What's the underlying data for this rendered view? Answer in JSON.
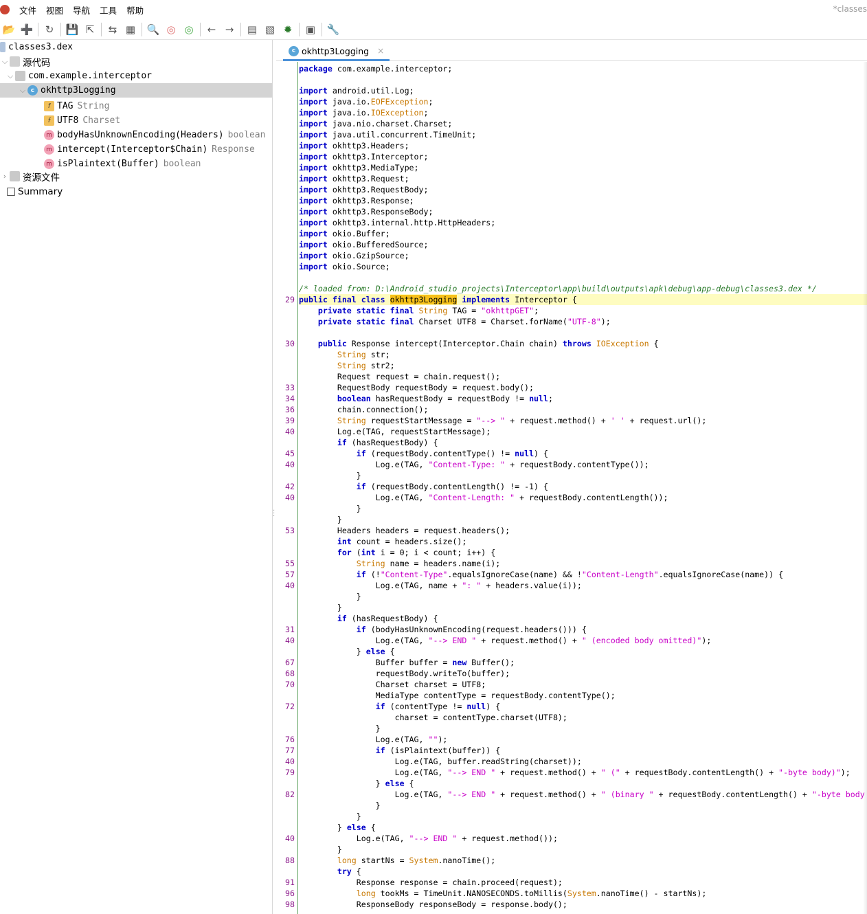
{
  "menu": {
    "items": [
      "文件",
      "视图",
      "导航",
      "工具",
      "帮助"
    ],
    "window_title": "*classes"
  },
  "toolbar": {
    "icons": [
      "open-icon",
      "add-files-icon",
      "reload-icon",
      "save-icon",
      "export-icon",
      "sync-icon",
      "tree-icon",
      "search-icon",
      "search-class-icon",
      "search-usage-icon",
      "back-icon",
      "forward-icon",
      "log-icon",
      "quark-icon",
      "debug-icon",
      "logs-icon",
      "prefs-icon"
    ]
  },
  "tree": {
    "root": "classes3.dex",
    "source_node": "源代码",
    "package": "com.example.interceptor",
    "class": "okhttp3Logging",
    "members": [
      {
        "icon": "f",
        "name": "TAG",
        "type": "String"
      },
      {
        "icon": "f",
        "name": "UTF8",
        "type": "Charset"
      },
      {
        "icon": "m",
        "name": "bodyHasUnknownEncoding(Headers)",
        "type": "boolean"
      },
      {
        "icon": "m",
        "name": "intercept(Interceptor$Chain)",
        "type": "Response"
      },
      {
        "icon": "m",
        "name": "isPlaintext(Buffer)",
        "type": "boolean"
      }
    ],
    "resources": "资源文件",
    "summary": "Summary"
  },
  "editor": {
    "tab_title": "okhttp3Logging",
    "tab_close": "×",
    "lines": [
      {
        "n": "",
        "html": "<span class=\"kw\">package</span> com.example.interceptor;"
      },
      {
        "n": "",
        "html": ""
      },
      {
        "n": "",
        "html": "<span class=\"kw\">import</span> android.util.Log;"
      },
      {
        "n": "",
        "html": "<span class=\"kw\">import</span> java.io.<span class=\"ty\">EOFException</span>;"
      },
      {
        "n": "",
        "html": "<span class=\"kw\">import</span> java.io.<span class=\"ty\">IOException</span>;"
      },
      {
        "n": "",
        "html": "<span class=\"kw\">import</span> java.nio.charset.Charset;"
      },
      {
        "n": "",
        "html": "<span class=\"kw\">import</span> java.util.concurrent.TimeUnit;"
      },
      {
        "n": "",
        "html": "<span class=\"kw\">import</span> okhttp3.Headers;"
      },
      {
        "n": "",
        "html": "<span class=\"kw\">import</span> okhttp3.Interceptor;"
      },
      {
        "n": "",
        "html": "<span class=\"kw\">import</span> okhttp3.MediaType;"
      },
      {
        "n": "",
        "html": "<span class=\"kw\">import</span> okhttp3.Request;"
      },
      {
        "n": "",
        "html": "<span class=\"kw\">import</span> okhttp3.RequestBody;"
      },
      {
        "n": "",
        "html": "<span class=\"kw\">import</span> okhttp3.Response;"
      },
      {
        "n": "",
        "html": "<span class=\"kw\">import</span> okhttp3.ResponseBody;"
      },
      {
        "n": "",
        "html": "<span class=\"kw\">import</span> okhttp3.internal.http.HttpHeaders;"
      },
      {
        "n": "",
        "html": "<span class=\"kw\">import</span> okio.Buffer;"
      },
      {
        "n": "",
        "html": "<span class=\"kw\">import</span> okio.BufferedSource;"
      },
      {
        "n": "",
        "html": "<span class=\"kw\">import</span> okio.GzipSource;"
      },
      {
        "n": "",
        "html": "<span class=\"kw\">import</span> okio.Source;"
      },
      {
        "n": "",
        "html": ""
      },
      {
        "n": "",
        "html": "<span class=\"cm\">/* loaded from: D:\\Android_studio_projects\\Interceptor\\app\\build\\outputs\\apk\\debug\\app-debug\\classes3.dex */</span>"
      },
      {
        "n": "29",
        "hl": true,
        "html": "<span class=\"kw\">public final class</span> <span class=\"hlname\">okhttp3Logging</span> <span class=\"kw\">implements</span> Interceptor {"
      },
      {
        "n": "",
        "html": "    <span class=\"kw\">private static final</span> <span class=\"ty\">String</span> TAG = <span class=\"str\">\"okhttpGET\"</span>;"
      },
      {
        "n": "",
        "html": "    <span class=\"kw\">private static final</span> Charset UTF8 = Charset.forName(<span class=\"str\">\"UTF-8\"</span>);"
      },
      {
        "n": "",
        "html": ""
      },
      {
        "n": "30",
        "html": "    <span class=\"kw\">public</span> Response intercept(Interceptor.Chain chain) <span class=\"kw\">throws</span> <span class=\"ty\">IOException</span> {"
      },
      {
        "n": "",
        "html": "        <span class=\"ty\">String</span> str;"
      },
      {
        "n": "",
        "html": "        <span class=\"ty\">String</span> str2;"
      },
      {
        "n": "",
        "html": "        Request request = chain.request();"
      },
      {
        "n": "33",
        "html": "        RequestBody requestBody = request.body();"
      },
      {
        "n": "34",
        "html": "        <span class=\"kw\">boolean</span> hasRequestBody = requestBody != <span class=\"kw\">null</span>;"
      },
      {
        "n": "36",
        "html": "        chain.connection();"
      },
      {
        "n": "39",
        "html": "        <span class=\"ty\">String</span> requestStartMessage = <span class=\"str\">\"--> \"</span> + request.method() + <span class=\"str\">' '</span> + request.url();"
      },
      {
        "n": "40",
        "html": "        Log.e(TAG, requestStartMessage);"
      },
      {
        "n": "",
        "html": "        <span class=\"kw\">if</span> (hasRequestBody) {"
      },
      {
        "n": "45",
        "html": "            <span class=\"kw\">if</span> (requestBody.contentType() != <span class=\"kw\">null</span>) {"
      },
      {
        "n": "40",
        "html": "                Log.e(TAG, <span class=\"str\">\"Content-Type: \"</span> + requestBody.contentType());"
      },
      {
        "n": "",
        "html": "            }"
      },
      {
        "n": "42",
        "html": "            <span class=\"kw\">if</span> (requestBody.contentLength() != -1) {"
      },
      {
        "n": "40",
        "html": "                Log.e(TAG, <span class=\"str\">\"Content-Length: \"</span> + requestBody.contentLength());"
      },
      {
        "n": "",
        "html": "            }"
      },
      {
        "n": "",
        "html": "        }"
      },
      {
        "n": "53",
        "html": "        Headers headers = request.headers();"
      },
      {
        "n": "",
        "html": "        <span class=\"kw\">int</span> count = headers.size();"
      },
      {
        "n": "",
        "html": "        <span class=\"kw\">for</span> (<span class=\"kw\">int</span> i = 0; i &lt; count; i++) {"
      },
      {
        "n": "55",
        "html": "            <span class=\"ty\">String</span> name = headers.name(i);"
      },
      {
        "n": "57",
        "html": "            <span class=\"kw\">if</span> (!<span class=\"str\">\"Content-Type\"</span>.equalsIgnoreCase(name) &amp;&amp; !<span class=\"str\">\"Content-Length\"</span>.equalsIgnoreCase(name)) {"
      },
      {
        "n": "40",
        "html": "                Log.e(TAG, name + <span class=\"str\">\": \"</span> + headers.value(i));"
      },
      {
        "n": "",
        "html": "            }"
      },
      {
        "n": "",
        "html": "        }"
      },
      {
        "n": "",
        "html": "        <span class=\"kw\">if</span> (hasRequestBody) {"
      },
      {
        "n": "31",
        "html": "            <span class=\"kw\">if</span> (bodyHasUnknownEncoding(request.headers())) {"
      },
      {
        "n": "40",
        "html": "                Log.e(TAG, <span class=\"str\">\"--> END \"</span> + request.method() + <span class=\"str\">\" (encoded body omitted)\"</span>);"
      },
      {
        "n": "",
        "html": "            } <span class=\"kw\">else</span> {"
      },
      {
        "n": "67",
        "html": "                Buffer buffer = <span class=\"kw\">new</span> Buffer();"
      },
      {
        "n": "68",
        "html": "                requestBody.writeTo(buffer);"
      },
      {
        "n": "70",
        "html": "                Charset charset = UTF8;"
      },
      {
        "n": "",
        "html": "                MediaType contentType = requestBody.contentType();"
      },
      {
        "n": "72",
        "html": "                <span class=\"kw\">if</span> (contentType != <span class=\"kw\">null</span>) {"
      },
      {
        "n": "",
        "html": "                    charset = contentType.charset(UTF8);"
      },
      {
        "n": "",
        "html": "                }"
      },
      {
        "n": "76",
        "html": "                Log.e(TAG, <span class=\"str\">\"\"</span>);"
      },
      {
        "n": "77",
        "html": "                <span class=\"kw\">if</span> (isPlaintext(buffer)) {"
      },
      {
        "n": "40",
        "html": "                    Log.e(TAG, buffer.readString(charset));"
      },
      {
        "n": "79",
        "html": "                    Log.e(TAG, <span class=\"str\">\"--> END \"</span> + request.method() + <span class=\"str\">\" (\"</span> + requestBody.contentLength() + <span class=\"str\">\"-byte body)\"</span>);"
      },
      {
        "n": "",
        "html": "                } <span class=\"kw\">else</span> {"
      },
      {
        "n": "82",
        "html": "                    Log.e(TAG, <span class=\"str\">\"--> END \"</span> + request.method() + <span class=\"str\">\" (binary \"</span> + requestBody.contentLength() + <span class=\"str\">\"-byte body omitted)\"</span>);"
      },
      {
        "n": "",
        "html": "                }"
      },
      {
        "n": "",
        "html": "            }"
      },
      {
        "n": "",
        "html": "        } <span class=\"kw\">else</span> {"
      },
      {
        "n": "40",
        "html": "            Log.e(TAG, <span class=\"str\">\"--> END \"</span> + request.method());"
      },
      {
        "n": "",
        "html": "        }"
      },
      {
        "n": "88",
        "html": "        <span class=\"ty\">long</span> startNs = <span class=\"ty\">System</span>.nanoTime();"
      },
      {
        "n": "",
        "html": "        <span class=\"kw\">try</span> {"
      },
      {
        "n": "91",
        "html": "            Response response = chain.proceed(request);"
      },
      {
        "n": "96",
        "html": "            <span class=\"ty\">long</span> tookMs = TimeUnit.NANOSECONDS.toMillis(<span class=\"ty\">System</span>.nanoTime() - startNs);"
      },
      {
        "n": "98",
        "html": "            ResponseBody responseBody = response.body();"
      }
    ]
  }
}
